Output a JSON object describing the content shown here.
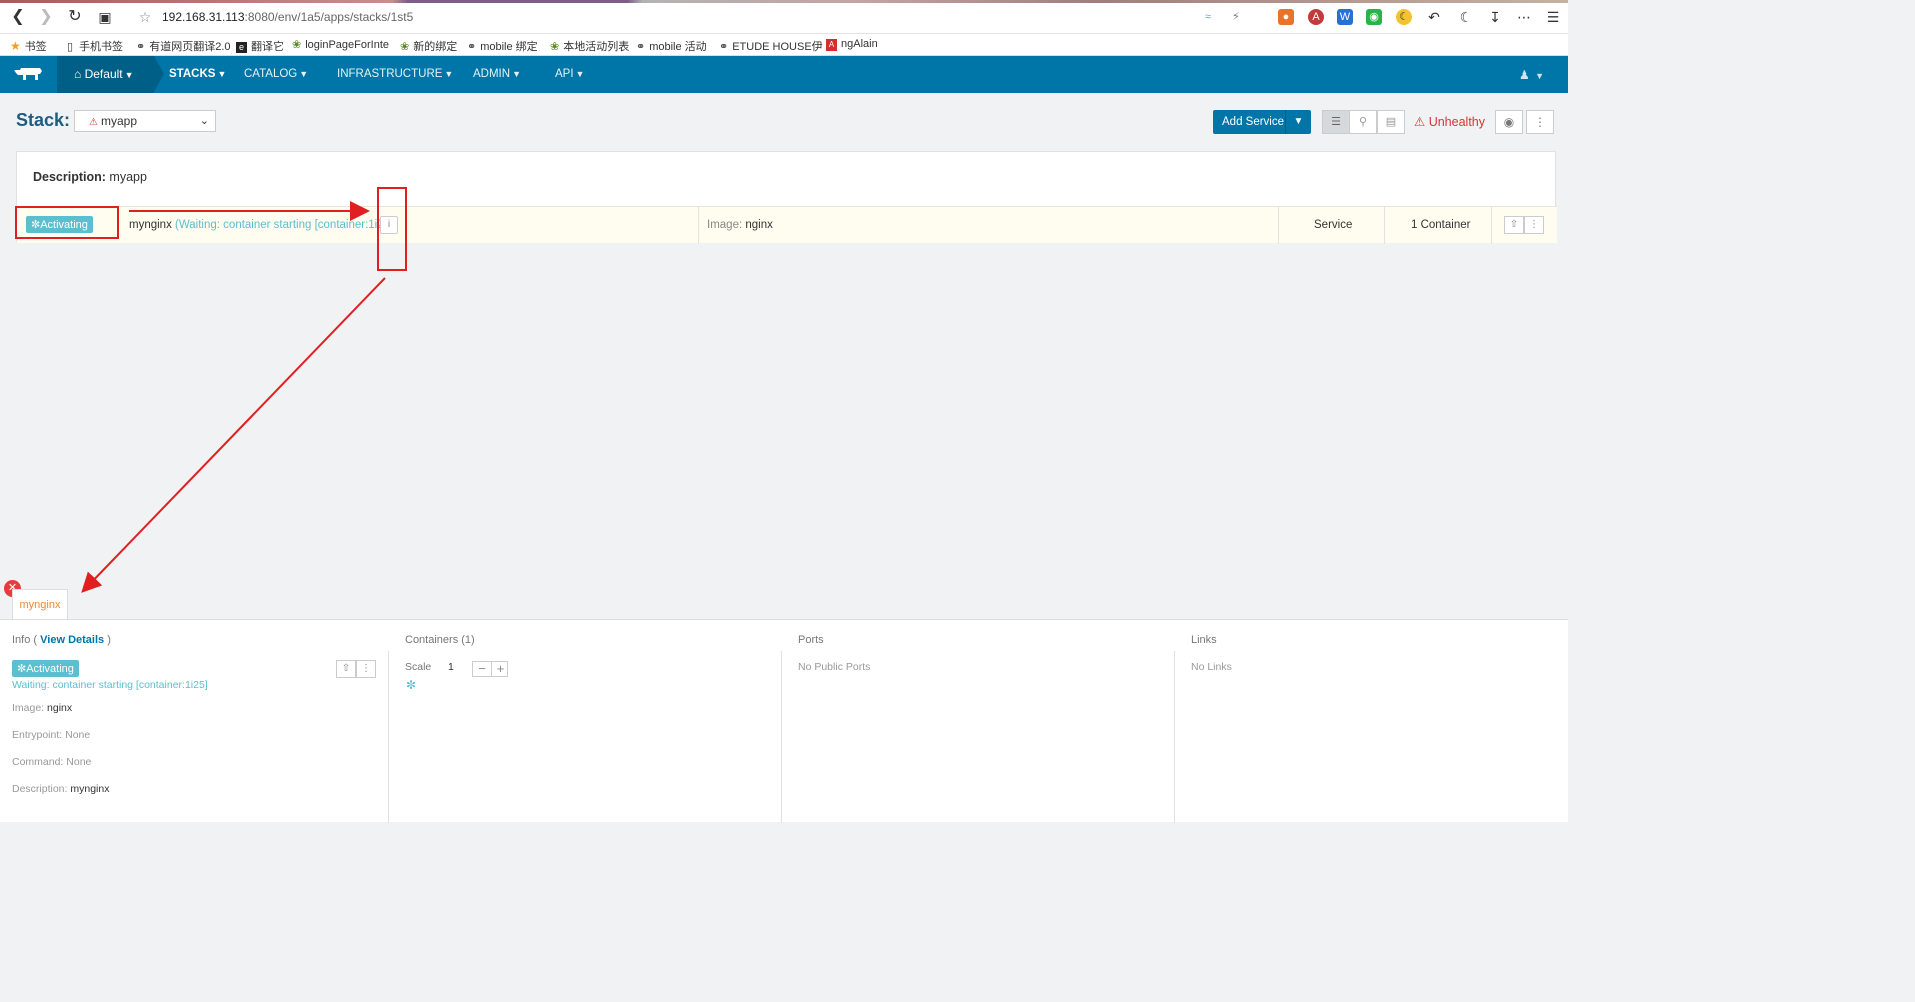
{
  "browser": {
    "url_host": "192.168.31.113",
    "url_path": ":8080/env/1a5/apps/stacks/1st5"
  },
  "bookmarks": [
    {
      "label": "书签",
      "icon": "star-icon"
    },
    {
      "label": "手机书签",
      "icon": "phone-icon"
    },
    {
      "label": "有道网页翻译2.0",
      "icon": "globe-icon"
    },
    {
      "label": "翻译它",
      "icon": "e-icon"
    },
    {
      "label": "loginPageForInte",
      "icon": "leaf-icon"
    },
    {
      "label": "新的绑定",
      "icon": "leaf-icon"
    },
    {
      "label": "mobile 绑定",
      "icon": "globe-icon"
    },
    {
      "label": "本地活动列表",
      "icon": "leaf-icon"
    },
    {
      "label": "mobile 活动",
      "icon": "globe-icon"
    },
    {
      "label": "ETUDE HOUSE伊",
      "icon": "globe-icon"
    },
    {
      "label": "ngAlain",
      "icon": "angular-icon"
    }
  ],
  "nav": {
    "env": "Default",
    "items": [
      "STACKS",
      "CATALOG",
      "INFRASTRUCTURE",
      "ADMIN",
      "API"
    ]
  },
  "stack": {
    "label": "Stack:",
    "name": "myapp",
    "add_service": "Add Service",
    "health": "Unhealthy",
    "description_label": "Description:",
    "description": "myapp"
  },
  "service": {
    "state": "Activating",
    "name": "mynginx",
    "message": "(Waiting: container starting [container:1i25])",
    "image_label": "Image:",
    "image": "nginx",
    "type": "Service",
    "containers": "1 Container"
  },
  "panel": {
    "tab": "mynginx",
    "info_head": "Info (",
    "view_details": "View Details",
    "info_close": ")",
    "state": "Activating",
    "waiting": "Waiting: container starting [container:1i25]",
    "image_label": "Image:",
    "image": "nginx",
    "entrypoint_label": "Entrypoint:",
    "entrypoint": "None",
    "command_label": "Command:",
    "command": "None",
    "description_label": "Description:",
    "description": "mynginx",
    "containers_head": "Containers (1)",
    "scale_label": "Scale",
    "scale_value": "1",
    "ports_head": "Ports",
    "ports_value": "No Public Ports",
    "links_head": "Links",
    "links_value": "No Links"
  },
  "colors": {
    "header": "#0075a8",
    "accent_teal": "#5bbfcf",
    "error_red": "#d93333",
    "annotation_red": "#e02020"
  }
}
